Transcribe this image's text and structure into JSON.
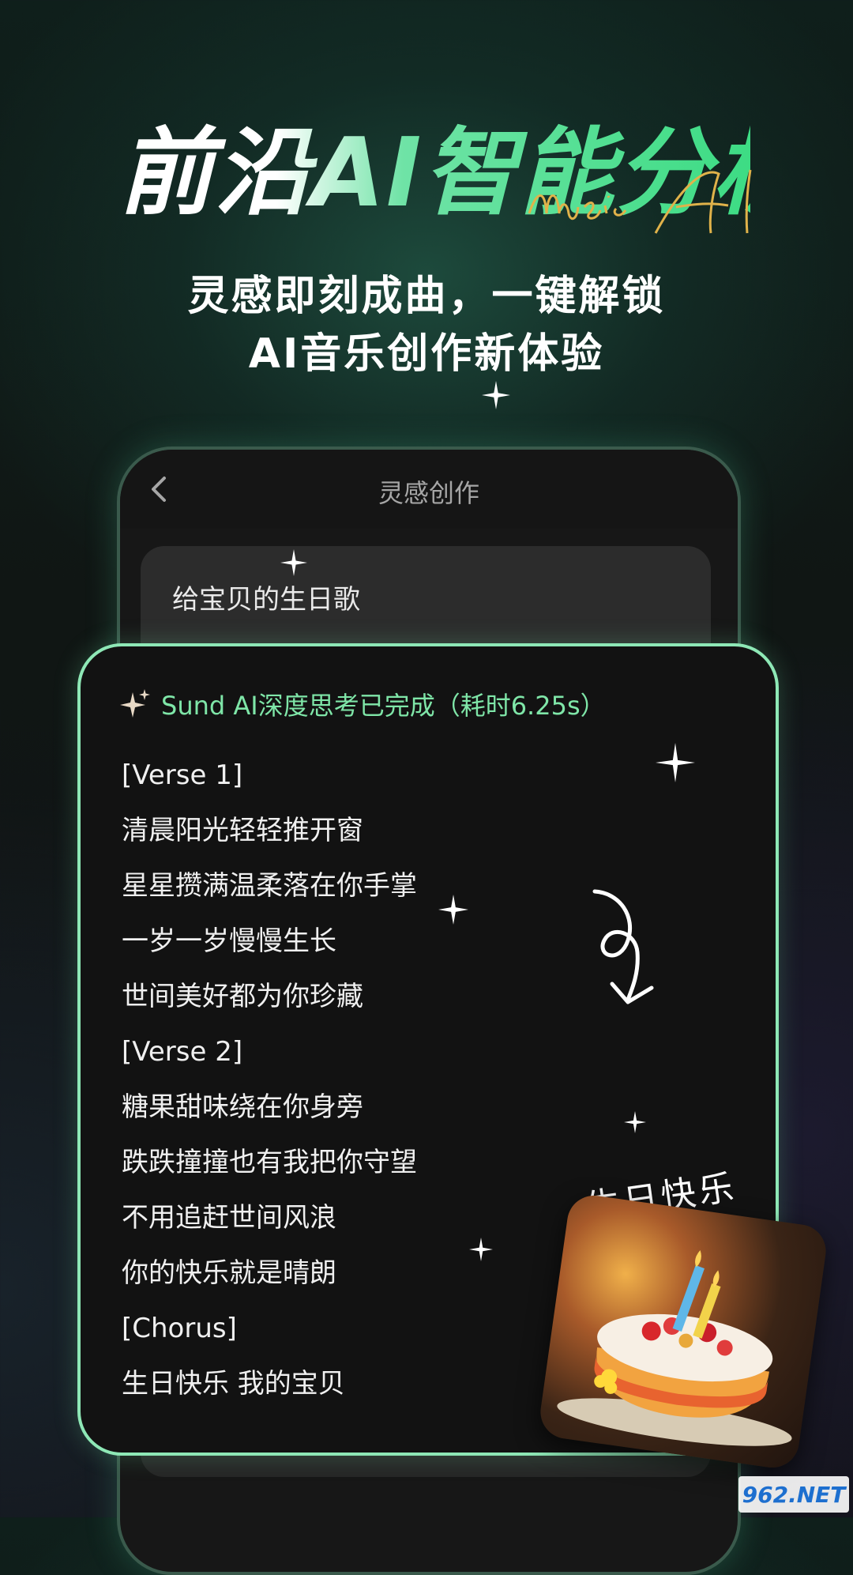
{
  "hero": {
    "headline": "前沿AI智能分析",
    "subtitle_line1": "灵感即刻成曲，一键解锁",
    "subtitle_line2": "AI音乐创作新体验"
  },
  "app": {
    "nav_title": "灵感创作",
    "prompt": "给宝贝的生日歌",
    "status": "Sund AI深度思考已完成（耗时6.25s）",
    "lyrics": [
      "[Verse 1]",
      "清晨阳光轻轻推开窗",
      "星星攒满温柔落在你手掌",
      "一岁一岁慢慢生长",
      "世间美好都为你珍藏",
      "[Verse 2]",
      "糖果甜味绕在你身旁",
      "跌跌撞撞也有我把你守望",
      "不用追赶世间风浪",
      "你的快乐就是晴朗",
      "[Chorus]",
      "生日快乐 我的宝贝"
    ]
  },
  "decor": {
    "cake_label": "生日快乐",
    "script_sign": "music AI",
    "watermark": "962.NET"
  },
  "colors": {
    "accent_green": "#7fe6a8",
    "card_border": "#8ee8b6",
    "background": "#101614"
  },
  "icons": {
    "back": "chevron-left-icon",
    "status": "sparkle-icon",
    "arrow": "curly-arrow-icon"
  }
}
